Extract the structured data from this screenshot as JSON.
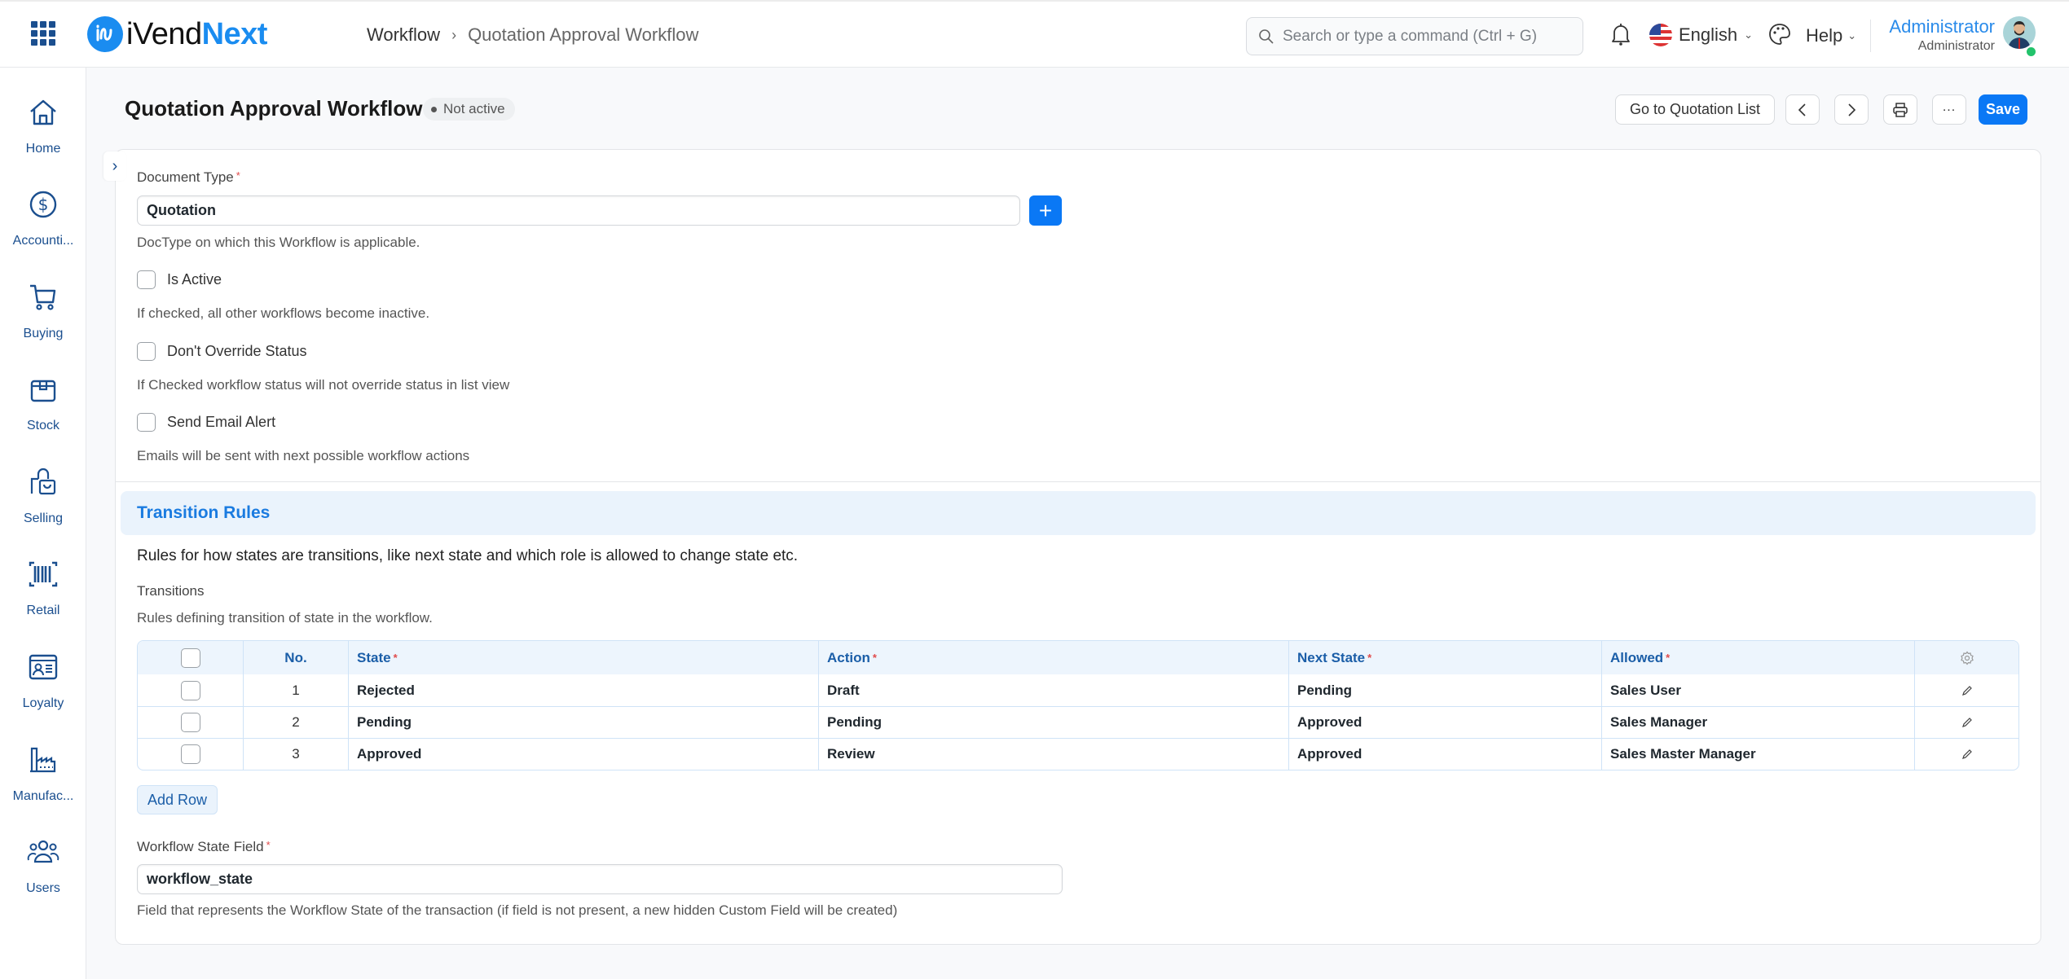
{
  "app": {
    "logo_part1": "iVend",
    "logo_part2": "Next",
    "brand_color": "#1a8cf0"
  },
  "breadcrumb": [
    "Workflow",
    "Quotation Approval Workflow"
  ],
  "search": {
    "placeholder": "Search or type a command (Ctrl + G)"
  },
  "navbar": {
    "language": "English",
    "help": "Help",
    "user_name": "Administrator",
    "user_role": "Administrator"
  },
  "sidebar": {
    "items": [
      {
        "label": "Home",
        "icon": "home-icon"
      },
      {
        "label": "Accounti...",
        "icon": "dollar-icon"
      },
      {
        "label": "Buying",
        "icon": "cart-icon"
      },
      {
        "label": "Stock",
        "icon": "box-icon"
      },
      {
        "label": "Selling",
        "icon": "shopping-bag-icon"
      },
      {
        "label": "Retail",
        "icon": "barcode-icon"
      },
      {
        "label": "Loyalty",
        "icon": "id-card-icon"
      },
      {
        "label": "Manufac...",
        "icon": "factory-icon"
      },
      {
        "label": "Users",
        "icon": "users-icon"
      }
    ]
  },
  "page": {
    "title": "Quotation Approval Workflow",
    "status": "Not active",
    "actions": {
      "goto_list": "Go to Quotation List",
      "save": "Save"
    }
  },
  "form": {
    "document_type": {
      "label": "Document Type",
      "value": "Quotation",
      "help": "DocType on which this Workflow is applicable."
    },
    "is_active": {
      "label": "Is Active",
      "checked": false,
      "help": "If checked, all other workflows become inactive."
    },
    "dont_override_status": {
      "label": "Don't Override Status",
      "checked": false,
      "help": "If Checked workflow status will not override status in list view"
    },
    "send_email_alert": {
      "label": "Send Email Alert",
      "checked": false,
      "help": "Emails will be sent with next possible workflow actions"
    },
    "transition_rules": {
      "title": "Transition Rules",
      "description": "Rules for how states are transitions, like next state and which role is allowed to change state etc.",
      "transitions_label": "Transitions",
      "transitions_help": "Rules defining transition of state in the workflow.",
      "columns": [
        "No.",
        "State",
        "Action",
        "Next State",
        "Allowed"
      ],
      "rows": [
        {
          "no": "1",
          "state": "Rejected",
          "action": "Draft",
          "next_state": "Pending",
          "allowed": "Sales User"
        },
        {
          "no": "2",
          "state": "Pending",
          "action": "Pending",
          "next_state": "Approved",
          "allowed": "Sales Manager"
        },
        {
          "no": "3",
          "state": "Approved",
          "action": "Review",
          "next_state": "Approved",
          "allowed": "Sales Master Manager"
        }
      ],
      "add_row": "Add Row"
    },
    "workflow_state_field": {
      "label": "Workflow State Field",
      "value": "workflow_state",
      "help": "Field that represents the Workflow State of the transaction (if field is not present, a new hidden Custom Field will be created)"
    }
  }
}
